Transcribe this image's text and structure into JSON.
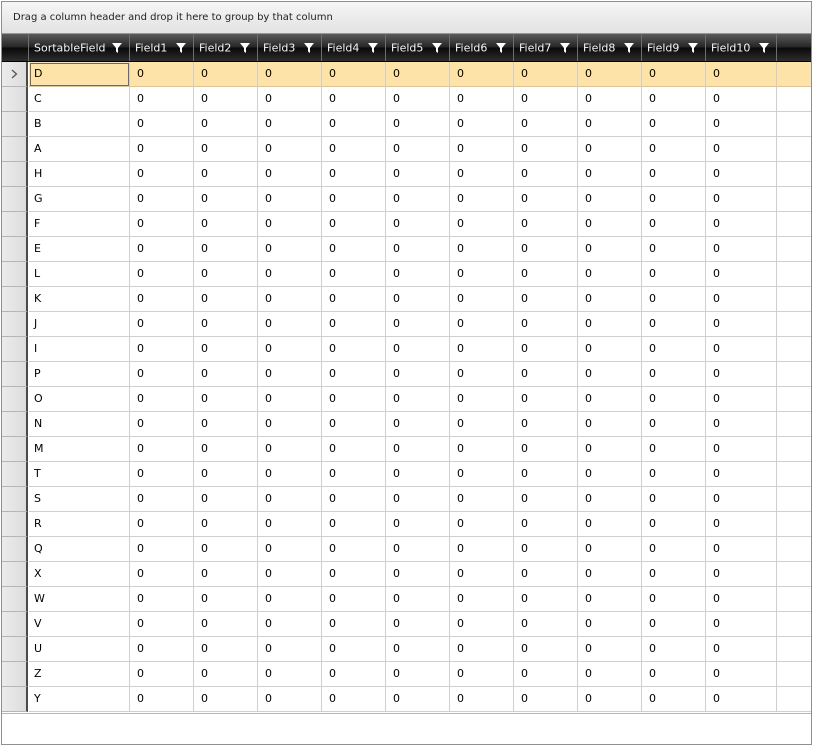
{
  "group_panel": {
    "text": "Drag a column header and drop it here to group by that column"
  },
  "columns": [
    {
      "label": "SortableField",
      "key": "sortable"
    },
    {
      "label": "Field1",
      "key": "f1"
    },
    {
      "label": "Field2",
      "key": "f2"
    },
    {
      "label": "Field3",
      "key": "f3"
    },
    {
      "label": "Field4",
      "key": "f4"
    },
    {
      "label": "Field5",
      "key": "f5"
    },
    {
      "label": "Field6",
      "key": "f6"
    },
    {
      "label": "Field7",
      "key": "f7"
    },
    {
      "label": "Field8",
      "key": "f8"
    },
    {
      "label": "Field9",
      "key": "f9"
    },
    {
      "label": "Field10",
      "key": "f10"
    }
  ],
  "rows": [
    {
      "sortable": "D",
      "selected": true,
      "values": [
        "0",
        "0",
        "0",
        "0",
        "0",
        "0",
        "0",
        "0",
        "0",
        "0"
      ]
    },
    {
      "sortable": "C",
      "values": [
        "0",
        "0",
        "0",
        "0",
        "0",
        "0",
        "0",
        "0",
        "0",
        "0"
      ]
    },
    {
      "sortable": "B",
      "values": [
        "0",
        "0",
        "0",
        "0",
        "0",
        "0",
        "0",
        "0",
        "0",
        "0"
      ]
    },
    {
      "sortable": "A",
      "values": [
        "0",
        "0",
        "0",
        "0",
        "0",
        "0",
        "0",
        "0",
        "0",
        "0"
      ]
    },
    {
      "sortable": "H",
      "values": [
        "0",
        "0",
        "0",
        "0",
        "0",
        "0",
        "0",
        "0",
        "0",
        "0"
      ]
    },
    {
      "sortable": "G",
      "values": [
        "0",
        "0",
        "0",
        "0",
        "0",
        "0",
        "0",
        "0",
        "0",
        "0"
      ]
    },
    {
      "sortable": "F",
      "values": [
        "0",
        "0",
        "0",
        "0",
        "0",
        "0",
        "0",
        "0",
        "0",
        "0"
      ]
    },
    {
      "sortable": "E",
      "values": [
        "0",
        "0",
        "0",
        "0",
        "0",
        "0",
        "0",
        "0",
        "0",
        "0"
      ]
    },
    {
      "sortable": "L",
      "values": [
        "0",
        "0",
        "0",
        "0",
        "0",
        "0",
        "0",
        "0",
        "0",
        "0"
      ]
    },
    {
      "sortable": "K",
      "values": [
        "0",
        "0",
        "0",
        "0",
        "0",
        "0",
        "0",
        "0",
        "0",
        "0"
      ]
    },
    {
      "sortable": "J",
      "values": [
        "0",
        "0",
        "0",
        "0",
        "0",
        "0",
        "0",
        "0",
        "0",
        "0"
      ]
    },
    {
      "sortable": "I",
      "values": [
        "0",
        "0",
        "0",
        "0",
        "0",
        "0",
        "0",
        "0",
        "0",
        "0"
      ]
    },
    {
      "sortable": "P",
      "values": [
        "0",
        "0",
        "0",
        "0",
        "0",
        "0",
        "0",
        "0",
        "0",
        "0"
      ]
    },
    {
      "sortable": "O",
      "values": [
        "0",
        "0",
        "0",
        "0",
        "0",
        "0",
        "0",
        "0",
        "0",
        "0"
      ]
    },
    {
      "sortable": "N",
      "values": [
        "0",
        "0",
        "0",
        "0",
        "0",
        "0",
        "0",
        "0",
        "0",
        "0"
      ]
    },
    {
      "sortable": "M",
      "values": [
        "0",
        "0",
        "0",
        "0",
        "0",
        "0",
        "0",
        "0",
        "0",
        "0"
      ]
    },
    {
      "sortable": "T",
      "values": [
        "0",
        "0",
        "0",
        "0",
        "0",
        "0",
        "0",
        "0",
        "0",
        "0"
      ]
    },
    {
      "sortable": "S",
      "values": [
        "0",
        "0",
        "0",
        "0",
        "0",
        "0",
        "0",
        "0",
        "0",
        "0"
      ]
    },
    {
      "sortable": "R",
      "values": [
        "0",
        "0",
        "0",
        "0",
        "0",
        "0",
        "0",
        "0",
        "0",
        "0"
      ]
    },
    {
      "sortable": "Q",
      "values": [
        "0",
        "0",
        "0",
        "0",
        "0",
        "0",
        "0",
        "0",
        "0",
        "0"
      ]
    },
    {
      "sortable": "X",
      "values": [
        "0",
        "0",
        "0",
        "0",
        "0",
        "0",
        "0",
        "0",
        "0",
        "0"
      ]
    },
    {
      "sortable": "W",
      "values": [
        "0",
        "0",
        "0",
        "0",
        "0",
        "0",
        "0",
        "0",
        "0",
        "0"
      ]
    },
    {
      "sortable": "V",
      "values": [
        "0",
        "0",
        "0",
        "0",
        "0",
        "0",
        "0",
        "0",
        "0",
        "0"
      ]
    },
    {
      "sortable": "U",
      "values": [
        "0",
        "0",
        "0",
        "0",
        "0",
        "0",
        "0",
        "0",
        "0",
        "0"
      ]
    },
    {
      "sortable": "Z",
      "values": [
        "0",
        "0",
        "0",
        "0",
        "0",
        "0",
        "0",
        "0",
        "0",
        "0"
      ]
    },
    {
      "sortable": "Y",
      "values": [
        "0",
        "0",
        "0",
        "0",
        "0",
        "0",
        "0",
        "0",
        "0",
        "0"
      ]
    }
  ],
  "icons": {
    "filter": "filter-funnel-icon",
    "current_row": "chevron-right-icon"
  },
  "colors": {
    "selected_row": "#fde3a7",
    "header_bg": "#1a1a1a",
    "header_text": "#f5f5f5"
  }
}
